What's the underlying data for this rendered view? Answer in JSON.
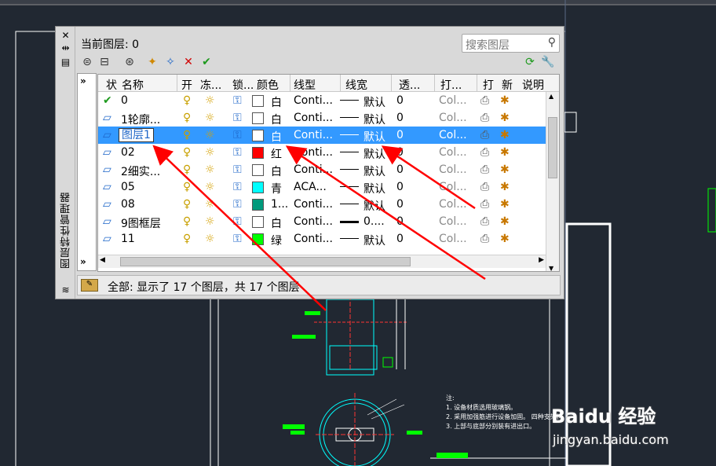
{
  "panel": {
    "title": "图层特性管理器",
    "current_layer": "当前图层: 0",
    "search_placeholder": "搜索图层",
    "status_text": "全部: 显示了 17 个图层，共 17 个图层"
  },
  "columns": [
    "状",
    "名称",
    "开",
    "冻...",
    "锁...",
    "颜色",
    "线型",
    "线宽",
    "透...",
    "打...",
    "打",
    "新",
    "说明"
  ],
  "rows": [
    {
      "name": "0",
      "color_name": "白",
      "color": "#ffffff",
      "linetype": "Conti...",
      "lineweight": "默认",
      "transp": "0",
      "plotstyle": "Col...",
      "current": true
    },
    {
      "name": "1轮廓...",
      "color_name": "白",
      "color": "#ffffff",
      "linetype": "Conti...",
      "lineweight": "默认",
      "transp": "0",
      "plotstyle": "Col..."
    },
    {
      "name": "图层1",
      "color_name": "白",
      "color": "#ffffff",
      "linetype": "Conti...",
      "lineweight": "默认",
      "transp": "0",
      "plotstyle": "Col...",
      "selected": true
    },
    {
      "name": "02",
      "color_name": "红",
      "color": "#ff0000",
      "linetype": "Conti...",
      "lineweight": "默认",
      "transp": "0",
      "plotstyle": "Col..."
    },
    {
      "name": "2细实...",
      "color_name": "白",
      "color": "#ffffff",
      "linetype": "Conti...",
      "lineweight": "默认",
      "transp": "0",
      "plotstyle": "Col..."
    },
    {
      "name": "05",
      "color_name": "青",
      "color": "#00ffff",
      "linetype": "ACA...",
      "lineweight": "默认",
      "transp": "0",
      "plotstyle": "Col..."
    },
    {
      "name": "08",
      "color_name": "1...",
      "color": "#009a7c",
      "linetype": "Conti...",
      "lineweight": "默认",
      "transp": "0",
      "plotstyle": "Col..."
    },
    {
      "name": "9图框层",
      "color_name": "白",
      "color": "#ffffff",
      "linetype": "Conti...",
      "lineweight": "0....",
      "transp": "0",
      "plotstyle": "Col...",
      "thick": true
    },
    {
      "name": "11",
      "color_name": "绿",
      "color": "#00ff00",
      "linetype": "Conti...",
      "lineweight": "默认",
      "transp": "0",
      "plotstyle": "Col..."
    }
  ],
  "notes": [
    "注:",
    "1. 设备材质选用玻璃钢。",
    "2. 采用加强筋进行设备加固。 四种支架构",
    "3. 上部与底部分别装有进出口。"
  ],
  "watermark": {
    "brand": "Baidu 经验",
    "url": "jingyan.baidu.com"
  },
  "icons": [
    "close-icon",
    "pin-icon",
    "properties-icon",
    "expand-icon",
    "new-property-filter-icon",
    "new-group-filter-icon",
    "layer-states-icon",
    "new-layer-icon",
    "new-layer-frozen-icon",
    "delete-layer-icon",
    "set-current-icon",
    "refresh-icon",
    "settings-icon",
    "search-icon",
    "lightbulb-icon",
    "sun-icon",
    "unlock-icon",
    "printer-icon",
    "new-vp-freeze-icon",
    "checkmark-icon",
    "layer-icon"
  ]
}
